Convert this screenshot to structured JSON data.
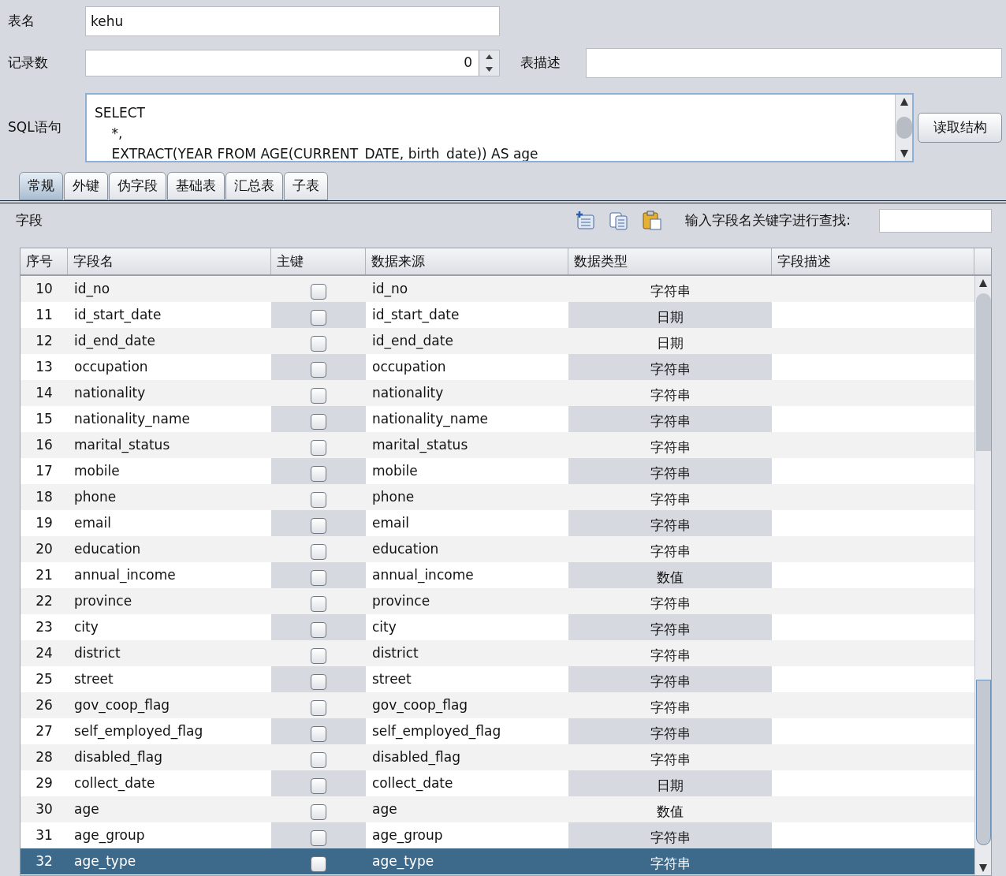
{
  "form": {
    "table_name_label": "表名",
    "table_name": "kehu",
    "record_count_label": "记录数",
    "record_count": "0",
    "description_label": "表描述",
    "sql_label": "SQL语句",
    "sql_lines": [
      "SELECT",
      "    *,",
      "    EXTRACT(YEAR FROM AGE(CURRENT_DATE, birth_date)) AS age"
    ],
    "read_button": "读取结构"
  },
  "tabs": [
    {
      "label": "常规",
      "selected": true
    },
    {
      "label": "外键",
      "selected": false
    },
    {
      "label": "伪字段",
      "selected": false
    },
    {
      "label": "基础表",
      "selected": false
    },
    {
      "label": "汇总表",
      "selected": false
    },
    {
      "label": "子表",
      "selected": false
    }
  ],
  "toolbar": {
    "title": "字段",
    "search_label": "输入字段名关键字进行查找:"
  },
  "table": {
    "columns": [
      "序号",
      "字段名",
      "主键",
      "数据来源",
      "数据类型",
      "字段描述"
    ],
    "rows": [
      {
        "no": "10",
        "name": "id_no",
        "pk": false,
        "source": "id_no",
        "type": "字符串",
        "selected": false
      },
      {
        "no": "11",
        "name": "id_start_date",
        "pk": false,
        "source": "id_start_date",
        "type": "日期",
        "selected": false
      },
      {
        "no": "12",
        "name": "id_end_date",
        "pk": false,
        "source": "id_end_date",
        "type": "日期",
        "selected": false
      },
      {
        "no": "13",
        "name": "occupation",
        "pk": false,
        "source": "occupation",
        "type": "字符串",
        "selected": false
      },
      {
        "no": "14",
        "name": "nationality",
        "pk": false,
        "source": "nationality",
        "type": "字符串",
        "selected": false
      },
      {
        "no": "15",
        "name": "nationality_name",
        "pk": false,
        "source": "nationality_name",
        "type": "字符串",
        "selected": false
      },
      {
        "no": "16",
        "name": "marital_status",
        "pk": false,
        "source": "marital_status",
        "type": "字符串",
        "selected": false
      },
      {
        "no": "17",
        "name": "mobile",
        "pk": false,
        "source": "mobile",
        "type": "字符串",
        "selected": false
      },
      {
        "no": "18",
        "name": "phone",
        "pk": false,
        "source": "phone",
        "type": "字符串",
        "selected": false
      },
      {
        "no": "19",
        "name": "email",
        "pk": false,
        "source": "email",
        "type": "字符串",
        "selected": false
      },
      {
        "no": "20",
        "name": "education",
        "pk": false,
        "source": "education",
        "type": "字符串",
        "selected": false
      },
      {
        "no": "21",
        "name": "annual_income",
        "pk": false,
        "source": "annual_income",
        "type": "数值",
        "selected": false
      },
      {
        "no": "22",
        "name": "province",
        "pk": false,
        "source": "province",
        "type": "字符串",
        "selected": false
      },
      {
        "no": "23",
        "name": "city",
        "pk": false,
        "source": "city",
        "type": "字符串",
        "selected": false
      },
      {
        "no": "24",
        "name": "district",
        "pk": false,
        "source": "district",
        "type": "字符串",
        "selected": false
      },
      {
        "no": "25",
        "name": "street",
        "pk": false,
        "source": "street",
        "type": "字符串",
        "selected": false
      },
      {
        "no": "26",
        "name": "gov_coop_flag",
        "pk": false,
        "source": "gov_coop_flag",
        "type": "字符串",
        "selected": false
      },
      {
        "no": "27",
        "name": "self_employed_flag",
        "pk": false,
        "source": "self_employed_flag",
        "type": "字符串",
        "selected": false
      },
      {
        "no": "28",
        "name": "disabled_flag",
        "pk": false,
        "source": "disabled_flag",
        "type": "字符串",
        "selected": false
      },
      {
        "no": "29",
        "name": "collect_date",
        "pk": false,
        "source": "collect_date",
        "type": "日期",
        "selected": false
      },
      {
        "no": "30",
        "name": "age",
        "pk": false,
        "source": "age",
        "type": "数值",
        "selected": false
      },
      {
        "no": "31",
        "name": "age_group",
        "pk": false,
        "source": "age_group",
        "type": "字符串",
        "selected": false
      },
      {
        "no": "32",
        "name": "age_type",
        "pk": false,
        "source": "age_type",
        "type": "字符串",
        "selected": true
      }
    ]
  }
}
